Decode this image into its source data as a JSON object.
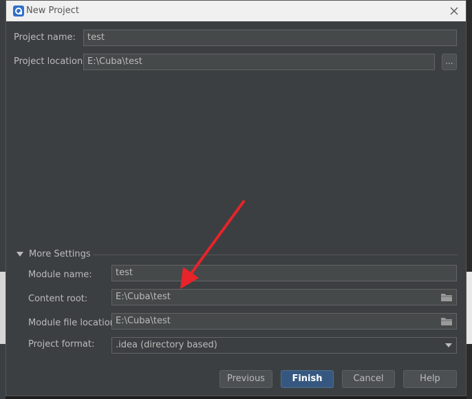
{
  "window": {
    "title": "New Project"
  },
  "project": {
    "name_label": "Project name:",
    "name_value": "test",
    "location_label": "Project location:",
    "location_value": "E:\\Cuba\\test",
    "browse_label": "..."
  },
  "more_settings": {
    "title": "More Settings",
    "module_name_label": "Module name:",
    "module_name_value": "test",
    "content_root_label": "Content root:",
    "content_root_value": "E:\\Cuba\\test",
    "module_file_label": "Module file location:",
    "module_file_value": "E:\\Cuba\\test",
    "format_label": "Project format:",
    "format_value": ".idea (directory based)"
  },
  "buttons": {
    "previous": "Previous",
    "finish": "Finish",
    "cancel": "Cancel",
    "help": "Help"
  },
  "colors": {
    "dialog_bg": "#3c3f41",
    "field_bg": "#45494a",
    "primary_button": "#365880",
    "annotation_arrow": "#e8232a"
  },
  "icons": [
    "app-logo-icon",
    "close-icon",
    "expand-triangle-icon",
    "folder-icon",
    "dropdown-arrow-icon"
  ]
}
